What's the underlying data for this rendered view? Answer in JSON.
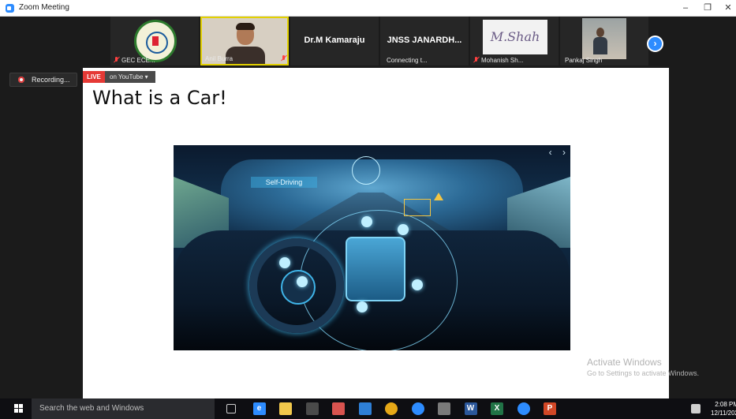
{
  "window": {
    "title": "Zoom Meeting",
    "minimize": "–",
    "maximize": "❐",
    "close": "✕"
  },
  "participants": [
    {
      "name": "GEC ECE...",
      "muted": true
    },
    {
      "name": "Anil Burra",
      "muted": true,
      "active_speaker": true
    },
    {
      "name": "Dr.M Kamaraju",
      "display_name": "Dr.M Kamaraju",
      "muted": false
    },
    {
      "name": "Connecting t...",
      "display_name": "JNSS JANARDH...",
      "muted": false
    },
    {
      "name": "Mohanish Sh...",
      "muted": true,
      "signature": "M.Shah"
    },
    {
      "name": "Pankaj Singh",
      "muted": false
    }
  ],
  "next_button": "›",
  "recording": {
    "label": "Recording..."
  },
  "live": {
    "badge": "LIVE",
    "platform": "on YouTube ▾"
  },
  "slide": {
    "title": "What is a Car!",
    "image_label": "Self-Driving",
    "nav_prev": "‹",
    "nav_next": "›"
  },
  "watermark": {
    "line1": "Activate Windows",
    "line2": "Go to Settings to activate Windows."
  },
  "taskbar": {
    "search_placeholder": "Search the web and Windows",
    "apps": [
      {
        "icon": "task-view-icon",
        "color": "#0e0e12"
      },
      {
        "icon": "edge-icon",
        "color": "#2d8cff",
        "label": "e"
      },
      {
        "icon": "file-explorer-icon",
        "color": "#f2c94c"
      },
      {
        "icon": "store-icon",
        "color": "#4a4a4a"
      },
      {
        "icon": "paint-icon",
        "color": "#d9534f"
      },
      {
        "icon": "photos-icon",
        "color": "#2e7fd6"
      },
      {
        "icon": "chrome-icon",
        "color": "#e6a817"
      },
      {
        "icon": "zoom-icon",
        "color": "#2d8cff"
      },
      {
        "icon": "media-player-icon",
        "color": "#7a7a7a"
      },
      {
        "icon": "word-icon",
        "color": "#2b579a",
        "label": "W"
      },
      {
        "icon": "excel-icon",
        "color": "#217346",
        "label": "X"
      },
      {
        "icon": "zoom-app-icon",
        "color": "#2d8cff"
      },
      {
        "icon": "powerpoint-icon",
        "color": "#d24726",
        "label": "P"
      }
    ],
    "time": "2:08 PM",
    "date": "12/11/202"
  },
  "colors": {
    "accent": "#2d8cff",
    "live": "#e53935",
    "active_speaker": "#e3d100"
  }
}
